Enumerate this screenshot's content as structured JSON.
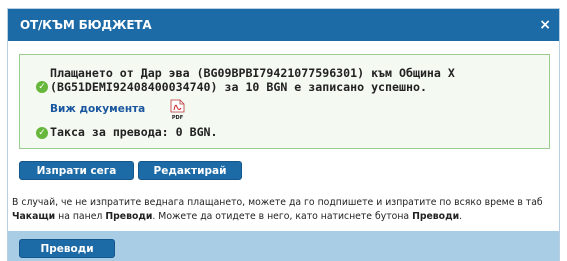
{
  "dialog": {
    "title": "ОТ/КЪМ БЮДЖЕТА",
    "close_glyph": "×"
  },
  "result": {
    "message": "Плащането от Дар                     эва (BG09BPBI79421077596301) към Община Х (BG51DEMI92408400034740) за 10 BGN е записано успешно.",
    "view_document_label": "Виж документа",
    "pdf_icon_text": "PDF",
    "fee_text": "Такса за превода: 0 BGN."
  },
  "actions": {
    "send_now_label": "Изпрати сега",
    "edit_label": "Редактирай"
  },
  "info": {
    "part1": "В случай, че не изпратите веднага плащането, можете да го подпишете и изпратите по всяко време в таб ",
    "pending_tab": "Чакащи",
    "part2": " на панел ",
    "transfers_panel": "Преводи",
    "part3": ". Можете да отидете в него, като натиснете бутона ",
    "transfers_button_ref": "Преводи",
    "part4": "."
  },
  "footer": {
    "transfers_label": "Преводи"
  },
  "colors": {
    "title_bar": "#1c6aa6",
    "success_border": "#9ccc8f",
    "success_bg": "#f4f9f1",
    "check_green": "#67b73c",
    "link_blue": "#1a57a0",
    "footer_bg": "#a8cde5"
  }
}
